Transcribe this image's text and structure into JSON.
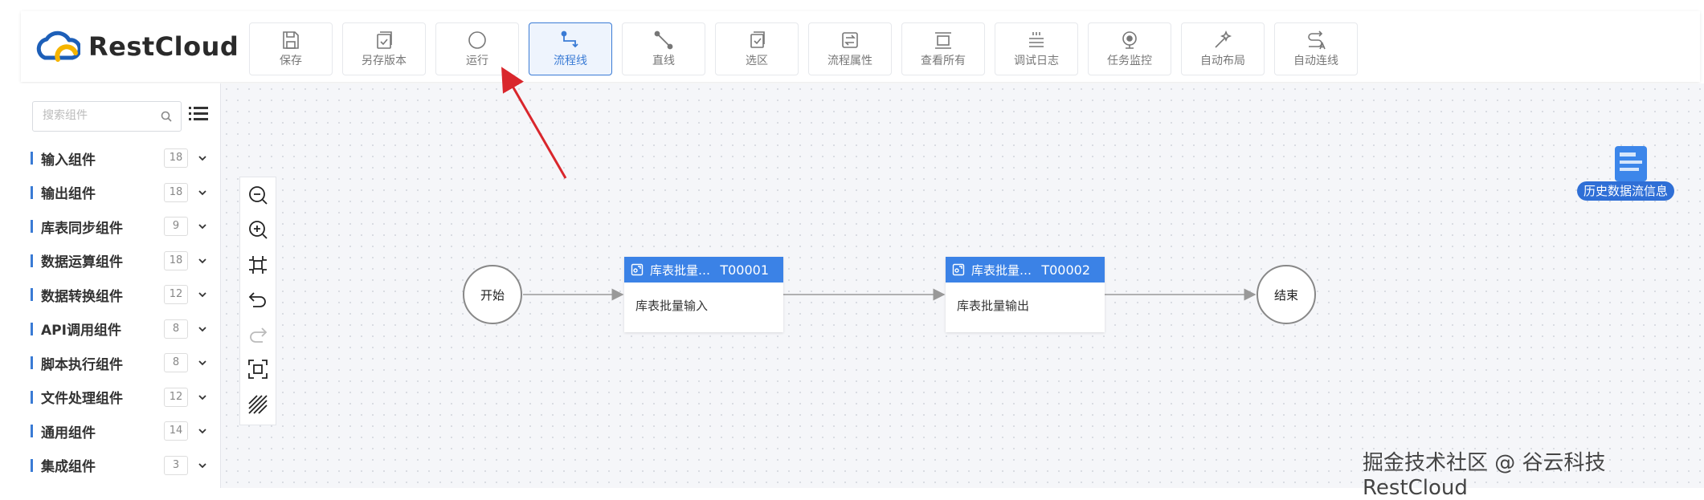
{
  "app": {
    "name": "RestCloud"
  },
  "toolbar": [
    {
      "label": "保存",
      "icon": "save-icon",
      "active": false
    },
    {
      "label": "另存版本",
      "icon": "save-version-icon",
      "active": false
    },
    {
      "label": "运行",
      "icon": "run-icon",
      "active": false
    },
    {
      "label": "流程线",
      "icon": "flow-line-icon",
      "active": true
    },
    {
      "label": "直线",
      "icon": "straight-line-icon",
      "active": false
    },
    {
      "label": "选区",
      "icon": "select-area-icon",
      "active": false
    },
    {
      "label": "流程属性",
      "icon": "flow-properties-icon",
      "active": false
    },
    {
      "label": "查看所有",
      "icon": "view-all-icon",
      "active": false
    },
    {
      "label": "调试日志",
      "icon": "debug-log-icon",
      "active": false
    },
    {
      "label": "任务监控",
      "icon": "task-monitor-icon",
      "active": false
    },
    {
      "label": "自动布局",
      "icon": "auto-layout-icon",
      "active": false
    },
    {
      "label": "自动连线",
      "icon": "auto-connect-icon",
      "active": false
    }
  ],
  "sidebar": {
    "search": {
      "placeholder": "搜索组件",
      "value": ""
    },
    "groups": [
      {
        "name": "输入组件",
        "count": "18"
      },
      {
        "name": "输出组件",
        "count": "18"
      },
      {
        "name": "库表同步组件",
        "count": "9"
      },
      {
        "name": "数据运算组件",
        "count": "18"
      },
      {
        "name": "数据转换组件",
        "count": "12"
      },
      {
        "name": "API调用组件",
        "count": "8"
      },
      {
        "name": "脚本执行组件",
        "count": "8"
      },
      {
        "name": "文件处理组件",
        "count": "12"
      },
      {
        "name": "通用组件",
        "count": "14"
      },
      {
        "name": "集成组件",
        "count": "3"
      }
    ]
  },
  "zoom_tools": [
    "zoom-out-icon",
    "zoom-in-icon",
    "fit-view-icon",
    "undo-icon",
    "redo-icon",
    "actual-size-icon",
    "grid-toggle-icon"
  ],
  "canvas": {
    "start": {
      "label": "开始"
    },
    "end": {
      "label": "结束"
    },
    "tasks": [
      {
        "title": "库表批量…",
        "id": "T00001",
        "body": "库表批量输入"
      },
      {
        "title": "库表批量…",
        "id": "T00002",
        "body": "库表批量输出"
      }
    ]
  },
  "history": {
    "label": "历史数据流信息"
  },
  "watermark": "掘金技术社区 @ 谷云科技RestCloud",
  "colors": {
    "accent": "#3a7bd5",
    "task_header": "#3b82e6",
    "arrow": "#d9262c"
  }
}
